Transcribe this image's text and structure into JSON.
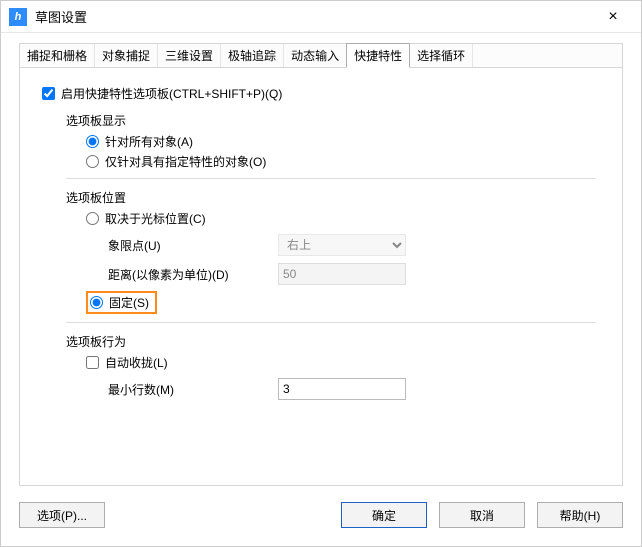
{
  "window": {
    "title": "草图设置"
  },
  "tabs": [
    "捕捉和栅格",
    "对象捕捉",
    "三维设置",
    "极轴追踪",
    "动态输入",
    "快捷特性",
    "选择循环"
  ],
  "activeTab": 5,
  "panel": {
    "enable_qp": "启用快捷特性选项板(CTRL+SHIFT+P)(Q)",
    "display": {
      "title": "选项板显示",
      "all": "针对所有对象(A)",
      "specific": "仅针对具有指定特性的对象(O)"
    },
    "position": {
      "title": "选项板位置",
      "by_cursor": "取决于光标位置(C)",
      "quadrant_label": "象限点(U)",
      "quadrant_value": "右上",
      "distance_label": "距离(以像素为单位)(D)",
      "distance_value": "50",
      "fixed": "固定(S)"
    },
    "behavior": {
      "title": "选项板行为",
      "auto_collapse": "自动收拢(L)",
      "minrows_label": "最小行数(M)",
      "minrows_value": "3"
    }
  },
  "buttons": {
    "options": "选项(P)...",
    "ok": "确定",
    "cancel": "取消",
    "help": "帮助(H)"
  }
}
